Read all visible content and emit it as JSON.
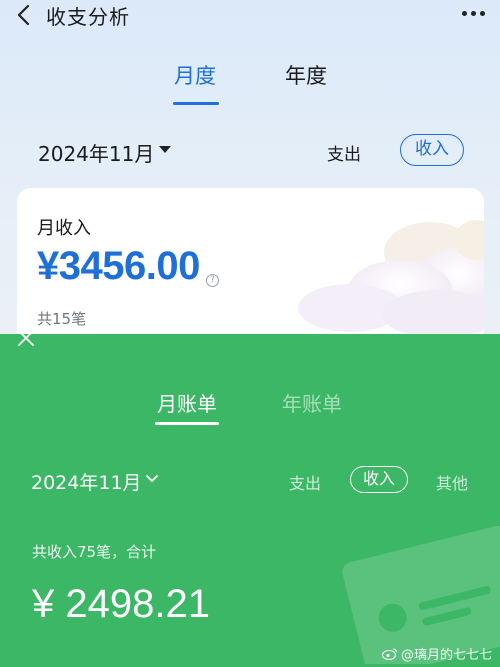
{
  "alipay": {
    "title": "收支分析",
    "tabs": [
      {
        "label": "月度"
      },
      {
        "label": "年度"
      }
    ],
    "date": "2024年11月",
    "filters": {
      "expense": "支出",
      "income": "收入"
    },
    "card": {
      "label": "月收入",
      "amount": "¥3456.00",
      "help": "?",
      "count": "共15笔"
    },
    "accent": "#1e6fd8"
  },
  "wechat": {
    "tabs": [
      {
        "label": "月账单"
      },
      {
        "label": "年账单"
      }
    ],
    "date": "2024年11月",
    "filters": {
      "expense": "支出",
      "income": "收入",
      "other": "其他"
    },
    "summary": "共收入75笔，合计",
    "amount": "¥ 2498.21",
    "accent": "#3cb765"
  },
  "watermark": "@璃月的七七七"
}
